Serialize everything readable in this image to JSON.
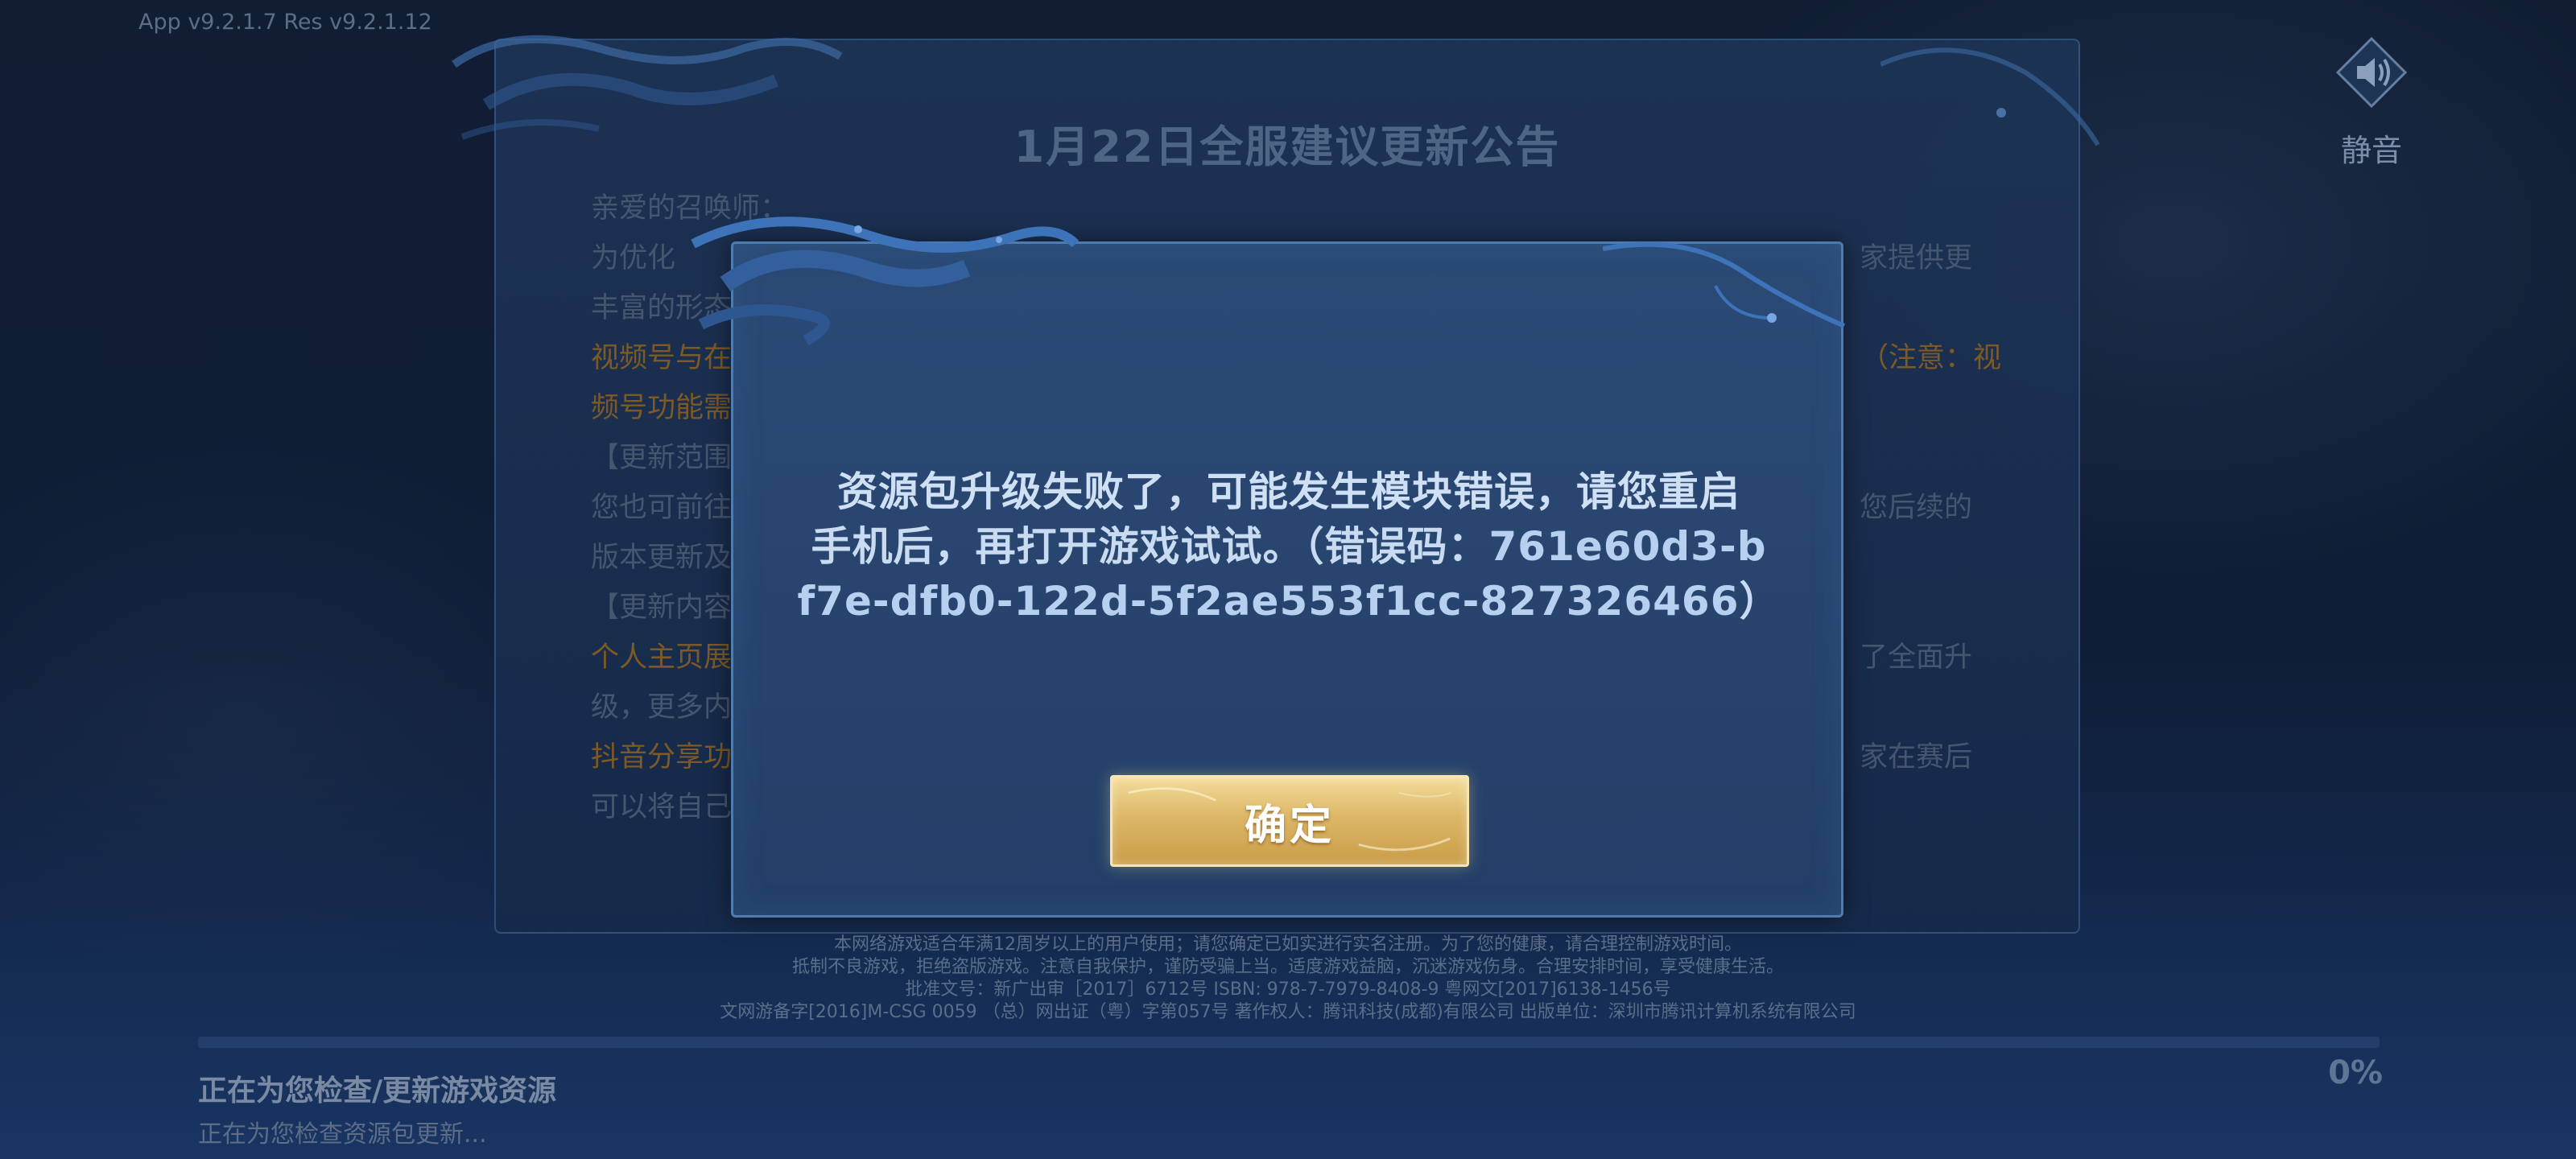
{
  "version_text": "App v9.2.1.7  Res v9.2.1.12",
  "mute": {
    "label": "静音",
    "icon": "speaker-icon"
  },
  "notice": {
    "title": "1月22日全服建议更新公告",
    "lines": [
      {
        "text": "亲爱的召唤师：",
        "style": "normal"
      },
      {
        "text": "为优化",
        "style": "normal"
      },
      {
        "text": "丰富的形态",
        "style": "normal"
      },
      {
        "text": "视频号与在",
        "style": "orange"
      },
      {
        "text": "频号功能需",
        "style": "orange"
      },
      {
        "text": "【更新范围",
        "style": "normal"
      },
      {
        "text": "您也可前往",
        "style": "normal"
      },
      {
        "text": "版本更新及",
        "style": "normal"
      },
      {
        "text": "【更新内容",
        "style": "normal"
      },
      {
        "text": "个人主页展",
        "style": "orange"
      },
      {
        "text": "级，更多内",
        "style": "normal"
      },
      {
        "text": "抖音分享功",
        "style": "orange"
      },
      {
        "text": "可以将自己",
        "style": "normal"
      }
    ],
    "right_fragments": [
      {
        "text": "家提供更",
        "style": "normal",
        "line": 1
      },
      {
        "text": "（注意：视",
        "style": "orange",
        "line": 3
      },
      {
        "text": "您后续的",
        "style": "normal",
        "line": 6
      },
      {
        "text": "了全面升",
        "style": "normal",
        "line": 9
      },
      {
        "text": "家在赛后",
        "style": "normal",
        "line": 11
      }
    ]
  },
  "dialog": {
    "message_line1": "资源包升级失败了，可能发生模块错误，请您重启",
    "message_line2_prefix": "手机后，再打开游戏试试。（错误码：",
    "error_code_part1": "761e60d3-b",
    "error_code_part2": "f7e-dfb0-122d-5f2ae553f1cc-827326466",
    "message_suffix": "）",
    "confirm_label": "确定"
  },
  "legal": [
    "本网络游戏适合年满12周岁以上的用户使用；请您确定已如实进行实名注册。为了您的健康，请合理控制游戏时间。",
    "抵制不良游戏，拒绝盗版游戏。注意自我保护，谨防受骗上当。适度游戏益脑，沉迷游戏伤身。合理安排时间，享受健康生活。",
    "批准文号：新广出审［2017］6712号  ISBN: 978-7-7979-8408-9  粤网文[2017]6138-1456号",
    "文网游备字[2016]M-CSG 0059  （总）网出证（粤）字第057号  著作权人：腾讯科技(成都)有限公司  出版单位：深圳市腾讯计算机系统有限公司"
  ],
  "progress": {
    "percent_text": "0%",
    "percent_value": 0,
    "status_title": "正在为您检查/更新游戏资源",
    "status_sub": "正在为您检查资源包更新..."
  },
  "colors": {
    "accent_gold": "#dcb767",
    "dialog_bg": "#284670",
    "dialog_border": "#4f7bae",
    "orange_text": "#7d5a25"
  }
}
